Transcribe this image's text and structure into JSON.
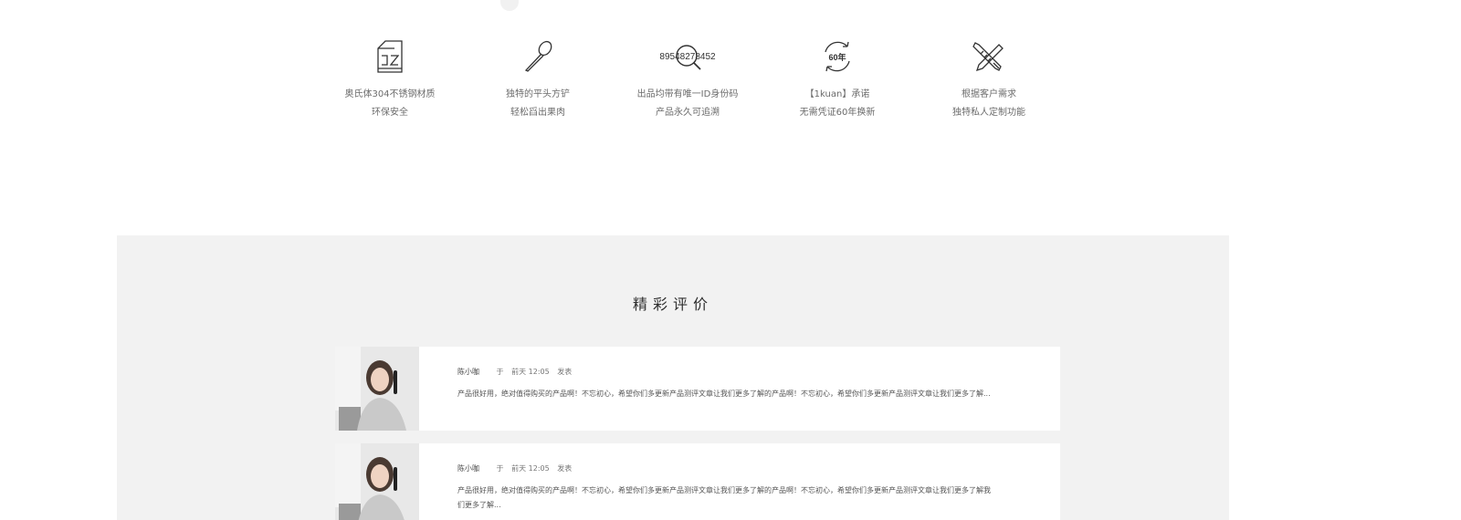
{
  "features": [
    {
      "icon": "cabinet-icon",
      "line1": "奥氏体304不锈钢材质",
      "line2": "环保安全"
    },
    {
      "icon": "spatula-icon",
      "line1": "独特的平头方铲",
      "line2": "轻松舀出果肉"
    },
    {
      "icon": "magnifier-id-icon",
      "icon_text": "89548278452",
      "line1": "出品均带有唯一ID身份码",
      "line2": "产品永久可追溯"
    },
    {
      "icon": "sixty-years-icon",
      "icon_text": "60年",
      "line1": "【1kuan】承诺",
      "line2": "无需凭证60年换新"
    },
    {
      "icon": "pencil-ruler-icon",
      "line1": "根据客户需求",
      "line2": "独特私人定制功能"
    }
  ],
  "reviews_section": {
    "title": "精彩评价",
    "items": [
      {
        "author": "陈小咖",
        "prefix": "于",
        "time": "前天 12:05",
        "suffix": "发表",
        "content": "产品很好用，绝对值得购买的产品啊！不忘初心，希望你们多更新产品测评文章让我们更多了解的产品啊！不忘初心，希望你们多更新产品测评文章让我们更多了解..."
      },
      {
        "author": "陈小咖",
        "prefix": "于",
        "time": "前天 12:05",
        "suffix": "发表",
        "content": "产品很好用，绝对值得购买的产品啊！不忘初心，希望你们多更新产品测评文章让我们更多了解的产品啊！不忘初心，希望你们多更新产品测评文章让我们更多了解我们更多了解..."
      }
    ]
  }
}
